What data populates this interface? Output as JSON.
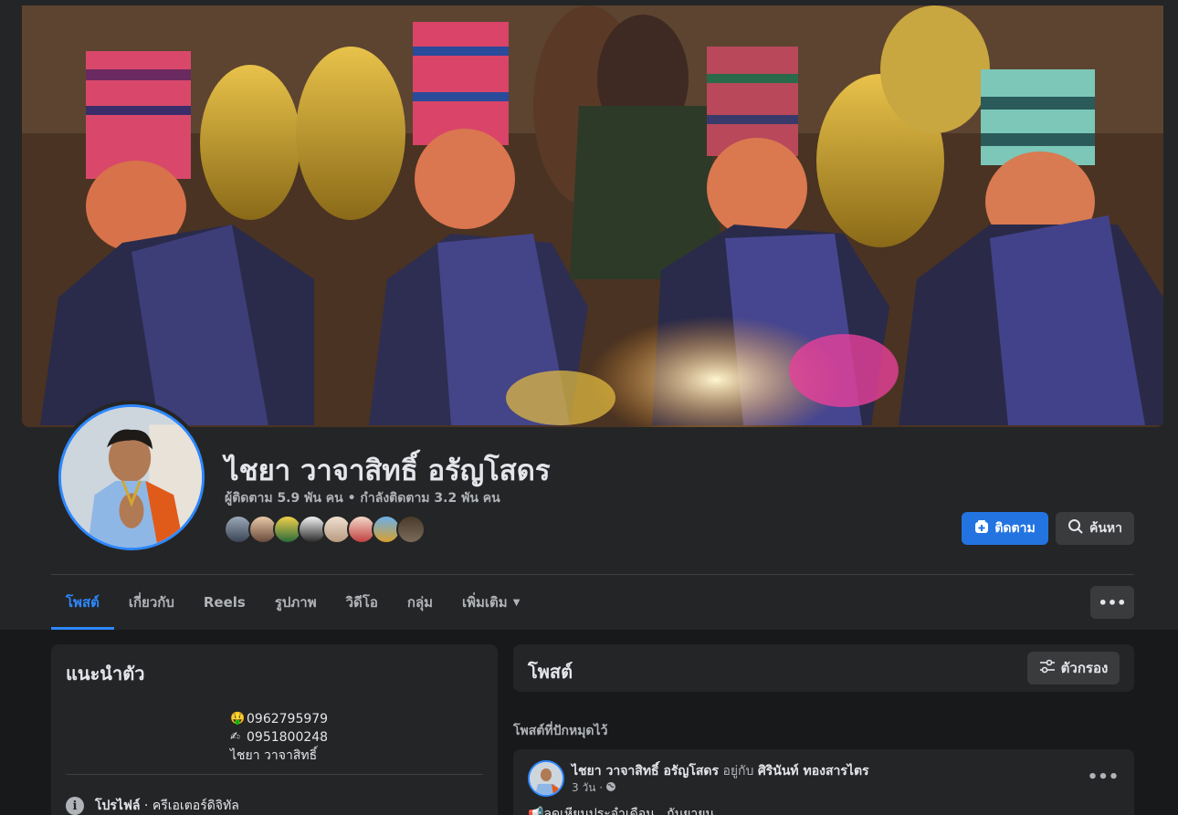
{
  "profile": {
    "name": "ไชยา วาจาสิทธิ์ อรัญโสดร",
    "stats": "ผู้ติดตาม 5.9 พัน คน • กำลังติดตาม 3.2 พัน คน"
  },
  "actions": {
    "follow_label": "ติดตาม",
    "search_label": "ค้นหา",
    "more_label": "•••"
  },
  "tabs": [
    {
      "label": "โพสต์"
    },
    {
      "label": "เกี่ยวกับ"
    },
    {
      "label": "Reels"
    },
    {
      "label": "รูปภาพ"
    },
    {
      "label": "วิดีโอ"
    },
    {
      "label": "กลุ่ม"
    },
    {
      "label": "เพิ่มเติม"
    }
  ],
  "intro": {
    "title": "แนะนำตัว",
    "bio": [
      {
        "emoji": "🤑",
        "text": "0962795979"
      },
      {
        "emoji": "✍",
        "text": "0951800248"
      },
      {
        "emoji": "",
        "text": "ไชยา วาจาสิทธิ์"
      }
    ],
    "info_label": "โปรไฟล์",
    "info_separator": " · ",
    "info_value": "ครีเอเตอร์ดิจิทัล"
  },
  "posts": {
    "title": "โพสต์",
    "filter_label": "ตัวกรอง",
    "pinned_label": "โพสต์ที่ปักหมุดไว้"
  },
  "post": {
    "author": "ไชยา วาจาสิทธิ์ อรัญโสดร",
    "with_text": " อยู่กับ ",
    "tagged": "ศิรินันท์ ทองสารไตร",
    "time": "3 วัน ·",
    "menu": "•••",
    "text": "📢ลดเหียนประจำเดือน...กันยายน"
  },
  "colors": {
    "accent": "#2d88ff",
    "follow_button": "#2374e1",
    "card": "#242526",
    "background": "#18191a"
  }
}
